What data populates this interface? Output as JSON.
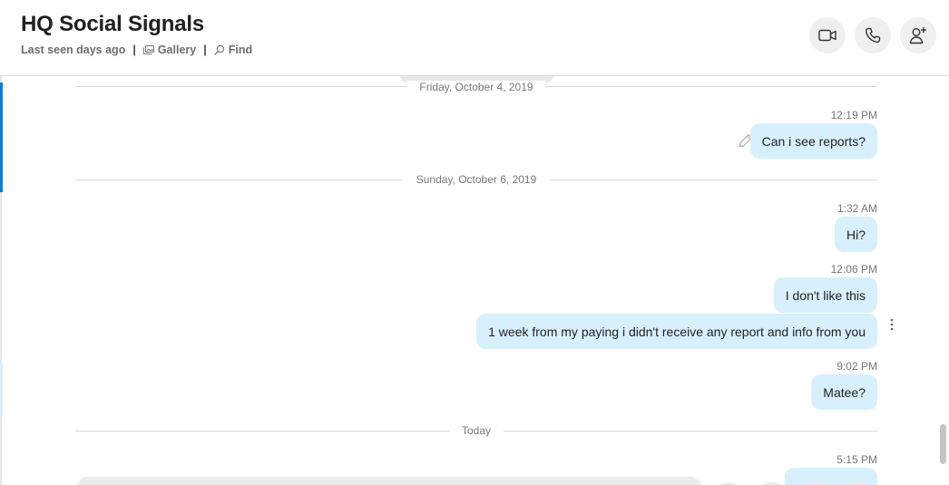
{
  "header": {
    "title": "HQ Social Signals",
    "status": "Last seen days ago",
    "gallery_label": "Gallery",
    "find_label": "Find",
    "separator": "|"
  },
  "icons": {
    "video": "video-camera-icon",
    "call": "phone-icon",
    "add_person": "add-person-icon",
    "gallery": "gallery-icon",
    "find": "search-icon",
    "edit": "pencil-icon",
    "more": "more-vertical-icon"
  },
  "colors": {
    "bubble": "#d8f0fc",
    "accent": "#0f7ad8",
    "header_button": "#efefef"
  },
  "chat": {
    "dividers": [
      "Friday, October 4, 2019",
      "Sunday, October 6, 2019",
      "Today"
    ],
    "messages": [
      {
        "time": "12:19 PM",
        "text": "Can i see reports?"
      },
      {
        "time": "1:32 AM",
        "text": "Hi?"
      },
      {
        "time": "12:06 PM",
        "text": "I don't like this"
      },
      {
        "time": "",
        "text": "1 week from my paying i didn't receive any report and info from you"
      },
      {
        "time": "9:02 PM",
        "text": "Matee?"
      },
      {
        "time": "5:15 PM",
        "text": ""
      }
    ]
  }
}
